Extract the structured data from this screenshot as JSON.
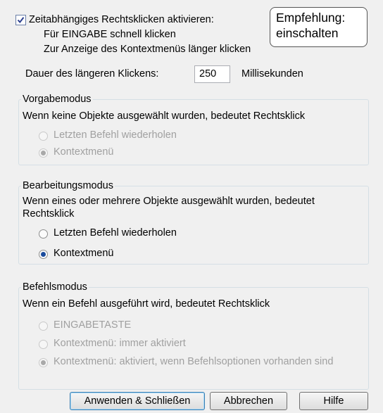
{
  "enable_option": {
    "label": "Zeitabhängiges Rechtsklicken aktivieren:",
    "checked": true,
    "hint_line1": "Für EINGABE schnell klicken",
    "hint_line2": "Zur Anzeige des Kontextmenüs länger klicken"
  },
  "recommendation": {
    "line1": "Empfehlung:",
    "line2": "einschalten"
  },
  "duration": {
    "label": "Dauer des längeren Klickens:",
    "value": "250",
    "unit": "Millisekunden"
  },
  "default_mode": {
    "title": "Vorgabemodus",
    "description": "Wenn keine Objekte ausgewählt wurden, bedeutet Rechtsklick",
    "options": [
      {
        "label": "Letzten Befehl wiederholen",
        "selected": false,
        "enabled": false
      },
      {
        "label": "Kontextmenü",
        "selected": true,
        "enabled": false
      }
    ]
  },
  "edit_mode": {
    "title": "Bearbeitungsmodus",
    "description_line1": "Wenn eines oder mehrere Objekte ausgewählt wurden, bedeutet",
    "description_line2": "Rechtsklick",
    "options": [
      {
        "label": "Letzten Befehl wiederholen",
        "selected": false,
        "enabled": true
      },
      {
        "label": "Kontextmenü",
        "selected": true,
        "enabled": true
      }
    ]
  },
  "command_mode": {
    "title": "Befehlsmodus",
    "description": "Wenn ein Befehl ausgeführt wird, bedeutet Rechtsklick",
    "options": [
      {
        "label": "EINGABETASTE",
        "selected": false,
        "enabled": false
      },
      {
        "label": "Kontextmenü: immer aktiviert",
        "selected": false,
        "enabled": false
      },
      {
        "label": "Kontextmenü: aktiviert, wenn Befehlsoptionen vorhanden sind",
        "selected": true,
        "enabled": false
      }
    ]
  },
  "buttons": {
    "apply": "Anwenden & Schließen",
    "cancel": "Abbrechen",
    "help": "Hilfe"
  }
}
